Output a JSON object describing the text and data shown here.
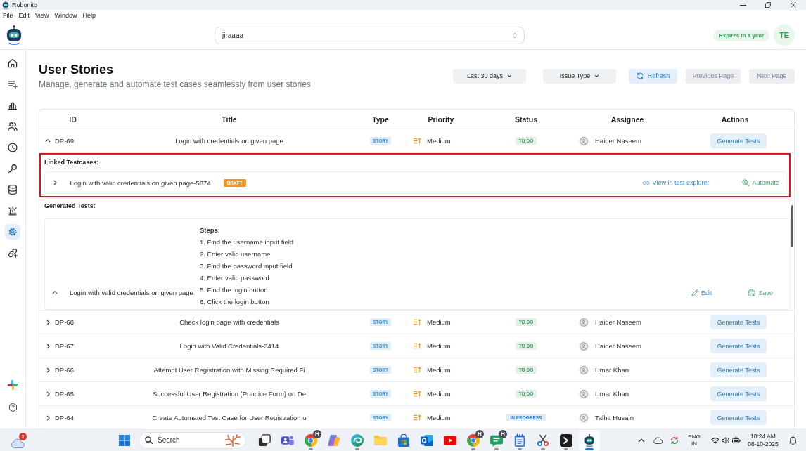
{
  "window": {
    "title": "Robonito"
  },
  "menu": [
    {
      "label": "File"
    },
    {
      "label": "Edit"
    },
    {
      "label": "View"
    },
    {
      "label": "Window"
    },
    {
      "label": "Help"
    }
  ],
  "header": {
    "project": {
      "value": "jiraaaa"
    },
    "license": "Expires in a year",
    "user_initials": "TE"
  },
  "sidebar": {
    "items": [
      {
        "selected": false
      },
      {
        "selected": false
      },
      {
        "selected": false
      },
      {
        "selected": false
      },
      {
        "selected": false
      },
      {
        "selected": false
      },
      {
        "selected": false
      },
      {
        "selected": false
      },
      {
        "selected": true
      },
      {
        "selected": false
      }
    ]
  },
  "page": {
    "title": "User Stories",
    "subtitle": "Manage, generate and automate test cases seamlessly from user stories"
  },
  "toolbar": {
    "date_filter": "Last 30 days",
    "type_filter": "Issue Type",
    "refresh": "Refresh",
    "pager": [
      {
        "label": "Previous Page",
        "disabled": true
      },
      {
        "label": "Next Page",
        "disabled": true
      }
    ]
  },
  "table": {
    "columns": [
      "ID",
      "Title",
      "Type",
      "Priority",
      "Status",
      "Assignee",
      "Actions"
    ],
    "rows": [
      {
        "id": "DP-69",
        "title": "Login with credentials on given page",
        "type": "STORY",
        "priority": "Medium",
        "status": {
          "label": "TO DO",
          "color": "#3a9b5c"
        },
        "assignee": "Haider Naseem",
        "action": "Generate Tests",
        "expanded": true,
        "details": {
          "highlighted": true,
          "linked_heading": "Linked Testcases:",
          "linked_testcases": [
            {
              "name": "Login with valid credentials on given page-5874",
              "status": "DRAFT",
              "expanded": false,
              "view_link": "View in test explorer",
              "automate_link": "Automate"
            }
          ],
          "generated_heading": "Generated Tests:",
          "generated_tests": [
            {
              "name": "Login with valid credentials on given page",
              "expanded": true,
              "steps_heading": "Steps:",
              "steps": [
                "1. Find the username input field",
                "2. Enter valid username",
                "3. Find the password input field",
                "4. Enter valid password",
                "5. Find the login button",
                "6. Click the login button"
              ],
              "edit": "Edit",
              "save": "Save"
            }
          ]
        }
      },
      {
        "id": "DP-68",
        "title": "Check login page with credentials",
        "type": "STORY",
        "priority": "Medium",
        "status": {
          "label": "TO DO",
          "color": "#3a9b5c"
        },
        "assignee": "Haider Naseem",
        "action": "Generate Tests",
        "expanded": false
      },
      {
        "id": "DP-67",
        "title": "Login with Valid Credentials-3414",
        "type": "STORY",
        "priority": "Medium",
        "status": {
          "label": "TO DO",
          "color": "#3a9b5c"
        },
        "assignee": "Haider Naseem",
        "action": "Generate Tests",
        "expanded": false
      },
      {
        "id": "DP-66",
        "title": "Attempt User Registration with Missing Required Fi",
        "type": "STORY",
        "priority": "Medium",
        "status": {
          "label": "TO DO",
          "color": "#3a9b5c"
        },
        "assignee": "Umar Khan",
        "action": "Generate Tests",
        "expanded": false
      },
      {
        "id": "DP-65",
        "title": "Successful User Registration (Practice Form) on De",
        "type": "STORY",
        "priority": "Medium",
        "status": {
          "label": "TO DO",
          "color": "#3a9b5c"
        },
        "assignee": "Umar Khan",
        "action": "Generate Tests",
        "expanded": false
      },
      {
        "id": "DP-64",
        "title": "Create Automated Test Case for User Registration o",
        "type": "STORY",
        "priority": "Medium",
        "status": {
          "label": "IN PROGRESS",
          "color": "#2f7fd0"
        },
        "assignee": "Talha Husain",
        "action": "Generate Tests",
        "expanded": false
      }
    ]
  },
  "taskbar": {
    "weather_badge": "2",
    "search": {
      "placeholder": "Search"
    },
    "apps": [
      {
        "running": false,
        "active": false
      },
      {
        "running": false,
        "active": false
      },
      {
        "running": true,
        "active": false,
        "badge": "H"
      },
      {
        "running": false,
        "active": false
      },
      {
        "running": true,
        "active": false
      },
      {
        "running": false,
        "active": false
      },
      {
        "running": false,
        "active": false
      },
      {
        "running": false,
        "active": false
      },
      {
        "running": false,
        "active": false
      },
      {
        "running": true,
        "active": false,
        "badge": "H"
      },
      {
        "running": true,
        "active": false,
        "badge": "H"
      },
      {
        "running": true,
        "active": false
      },
      {
        "running": true,
        "active": false
      },
      {
        "running": true,
        "active": false
      },
      {
        "running": true,
        "active": true
      }
    ],
    "language": "ENG",
    "region": "IN",
    "time": "10:24 AM",
    "date": "08-10-2025"
  }
}
